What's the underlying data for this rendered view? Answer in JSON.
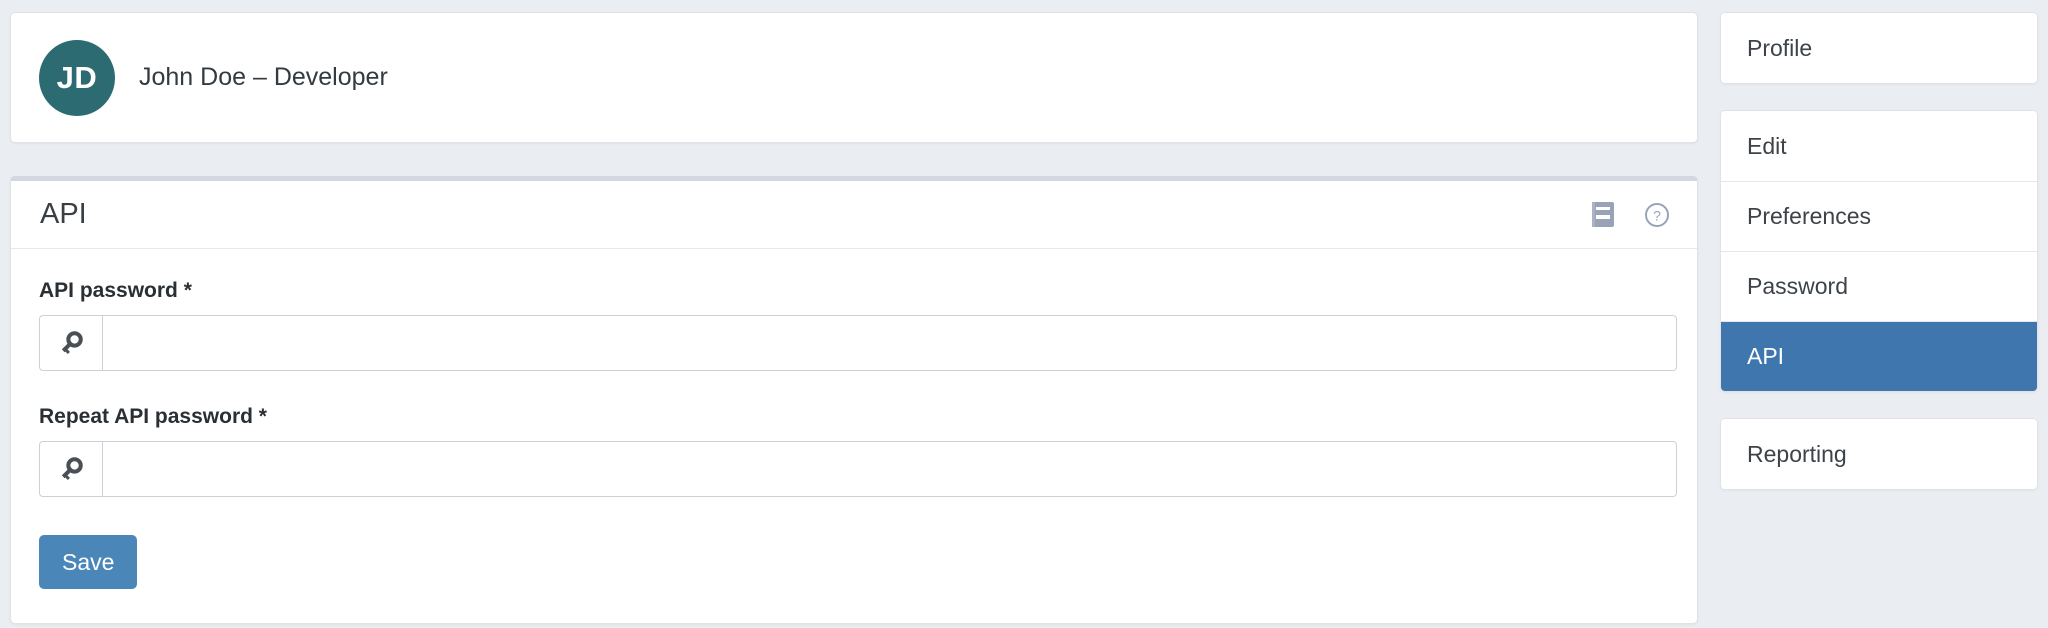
{
  "profile": {
    "avatar_initials": "JD",
    "name_role": "John Doe – Developer",
    "avatar_color": "#2d6b73"
  },
  "panel": {
    "title": "API",
    "tools": [
      {
        "icon": "manual-book-icon",
        "label": "Manual"
      },
      {
        "icon": "help-circle-icon",
        "label": "Help"
      }
    ],
    "fields": [
      {
        "label": "API password *",
        "icon": "key-icon",
        "value": "",
        "placeholder": ""
      },
      {
        "label": "Repeat API password *",
        "icon": "key-icon",
        "value": "",
        "placeholder": ""
      }
    ],
    "save_label": "Save",
    "save_color": "#4a87b8"
  },
  "sidebar": {
    "top_card": [
      {
        "label": "Profile",
        "active": false
      }
    ],
    "list_card": [
      {
        "label": "Edit",
        "active": false
      },
      {
        "label": "Preferences",
        "active": false
      },
      {
        "label": "Password",
        "active": false
      },
      {
        "label": "API",
        "active": true
      }
    ],
    "bottom_card": [
      {
        "label": "Reporting",
        "active": false
      }
    ],
    "active_color": "#3e76ad"
  },
  "theme": {
    "background": "#eaedf1",
    "card_background": "#ffffff",
    "border": "#dfe3e8"
  }
}
